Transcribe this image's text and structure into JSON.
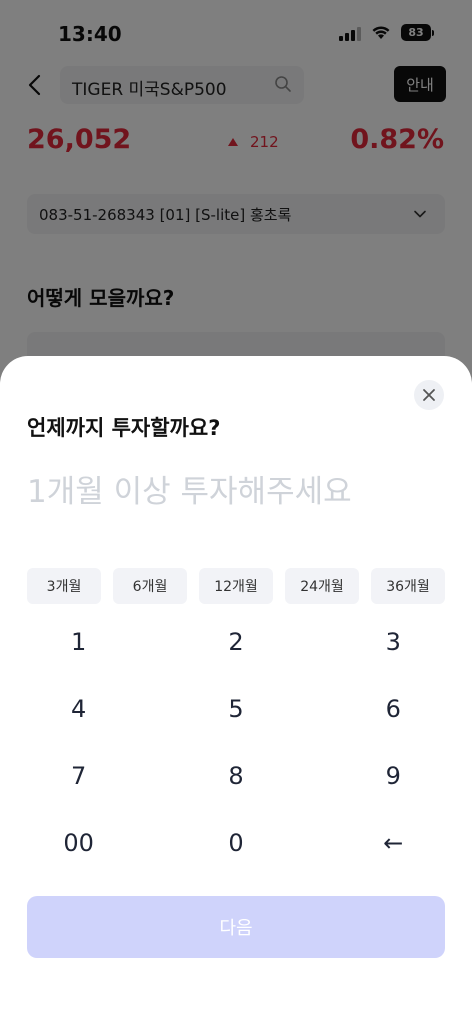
{
  "status": {
    "time": "13:40",
    "battery": "83"
  },
  "header": {
    "search_text": "TIGER 미국S&P500",
    "guide_label": "안내"
  },
  "quote": {
    "price": "26,052",
    "change": "212",
    "rate": "0.82%"
  },
  "account": {
    "text": "083-51-268343 [01] [S-lite] 홍초록"
  },
  "section": {
    "title": "어떻게 모을까요?"
  },
  "sheet": {
    "title": "언제까지 투자할까요?",
    "placeholder": "1개월 이상 투자해주세요",
    "chips": [
      "3개월",
      "6개월",
      "12개월",
      "24개월",
      "36개월"
    ],
    "keys": [
      [
        "1",
        "2",
        "3"
      ],
      [
        "4",
        "5",
        "6"
      ],
      [
        "7",
        "8",
        "9"
      ],
      [
        "00",
        "0",
        "←"
      ]
    ],
    "next_label": "다음"
  },
  "colors": {
    "accent_red": "#e2283b",
    "next_disabled": "#cfd3fb",
    "placeholder": "#cfd3d9"
  },
  "icons": [
    "back-arrow-icon",
    "search-icon",
    "chevron-down-icon",
    "close-icon",
    "signal-icon",
    "wifi-icon",
    "battery-icon"
  ]
}
